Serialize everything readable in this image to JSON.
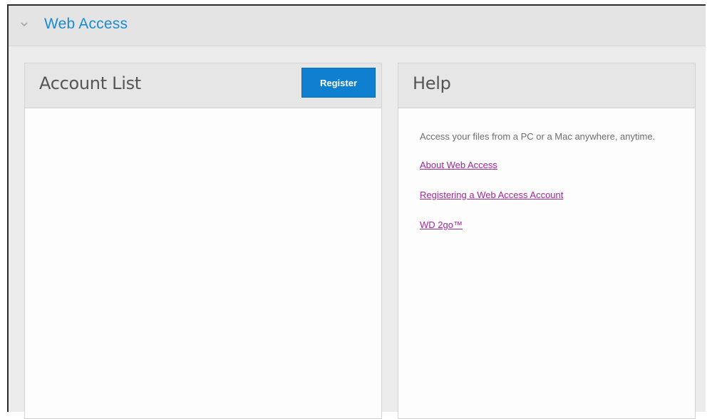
{
  "section": {
    "title": "Web Access",
    "toggle_icon": "chevron-down-icon"
  },
  "account_panel": {
    "title": "Account List",
    "register_label": "Register"
  },
  "help_panel": {
    "title": "Help",
    "description": "Access your files from a PC or a Mac anywhere, anytime.",
    "links": [
      {
        "label": "About Web Access"
      },
      {
        "label": "Registering a Web Access Account"
      },
      {
        "label": "WD 2go™"
      }
    ]
  },
  "colors": {
    "accent": "#1b8bd1",
    "button": "#0f7fcf",
    "link": "#a0269a"
  }
}
